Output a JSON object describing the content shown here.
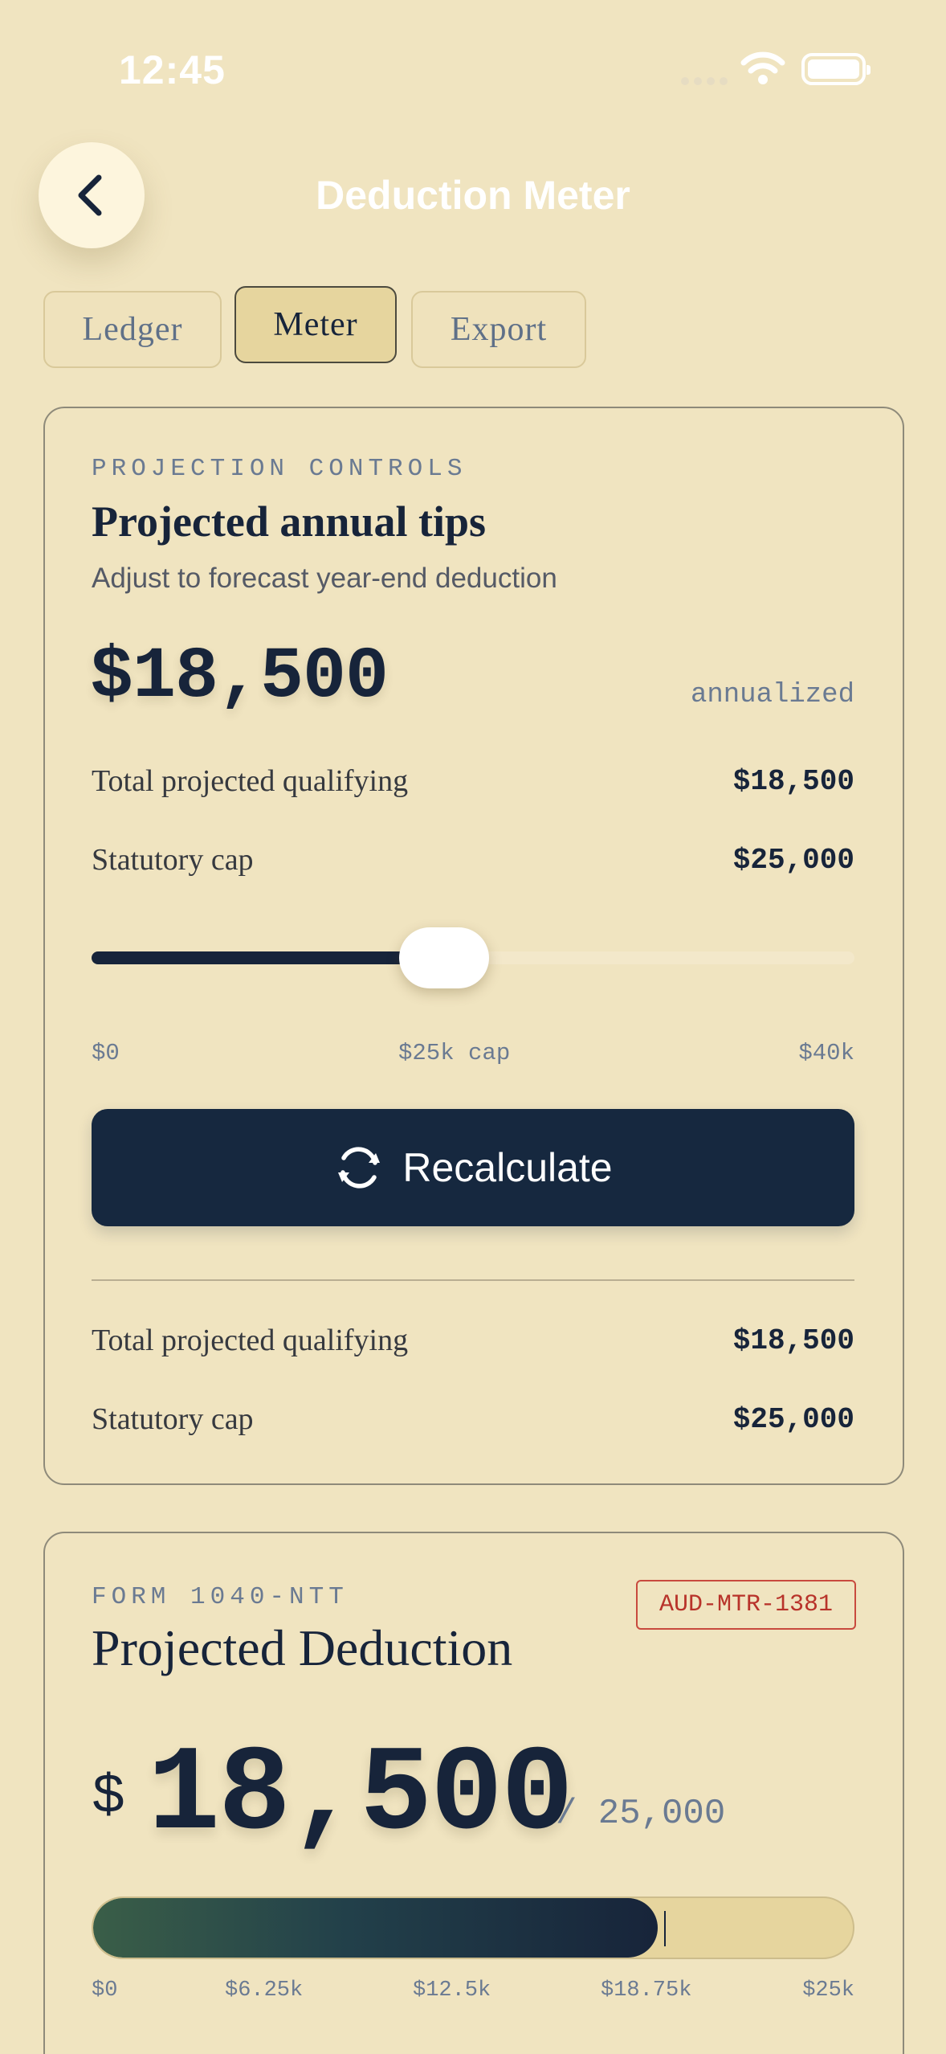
{
  "status_bar": {
    "time": "12:45"
  },
  "header": {
    "title": "Deduction Meter"
  },
  "tabs": [
    {
      "label": "Ledger",
      "active": false
    },
    {
      "label": "Meter",
      "active": true
    },
    {
      "label": "Export",
      "active": false
    }
  ],
  "projection": {
    "eyebrow": "PROJECTION CONTROLS",
    "title": "Projected annual tips",
    "subtitle": "Adjust to forecast year-end deduction",
    "amount": "$18,500",
    "amount_note": "annualized",
    "rows": [
      {
        "label": "Total projected qualifying",
        "value": "$18,500"
      },
      {
        "label": "Statutory cap",
        "value": "$25,000"
      }
    ],
    "slider": {
      "value": 18500,
      "min": 0,
      "max": 40000,
      "tick_labels": [
        "$0",
        "$25k cap",
        "$40k"
      ]
    },
    "recalculate_label": "Recalculate",
    "summary_rows": [
      {
        "label": "Total projected qualifying",
        "value": "$18,500"
      },
      {
        "label": "Statutory cap",
        "value": "$25,000"
      }
    ]
  },
  "deduction": {
    "eyebrow": "FORM 1040-NTT",
    "badge": "AUD-MTR-1381",
    "title": "Projected Deduction",
    "currency": "$",
    "amount": "18,500",
    "cap_text": "/ 25,000",
    "progress": {
      "value": 18500,
      "max": 25000
    },
    "tick_labels": [
      "$0",
      "$6.25k",
      "$12.5k",
      "$18.75k",
      "$25k"
    ]
  },
  "colors": {
    "background": "#f0e4c0",
    "navy": "#17243a",
    "badge_red": "#b8332a",
    "progress_green": "#3a5e48"
  },
  "icons": {
    "back": "chevron-left-icon",
    "recalculate": "refresh-icon",
    "wifi": "wifi-icon",
    "battery": "battery-icon"
  }
}
